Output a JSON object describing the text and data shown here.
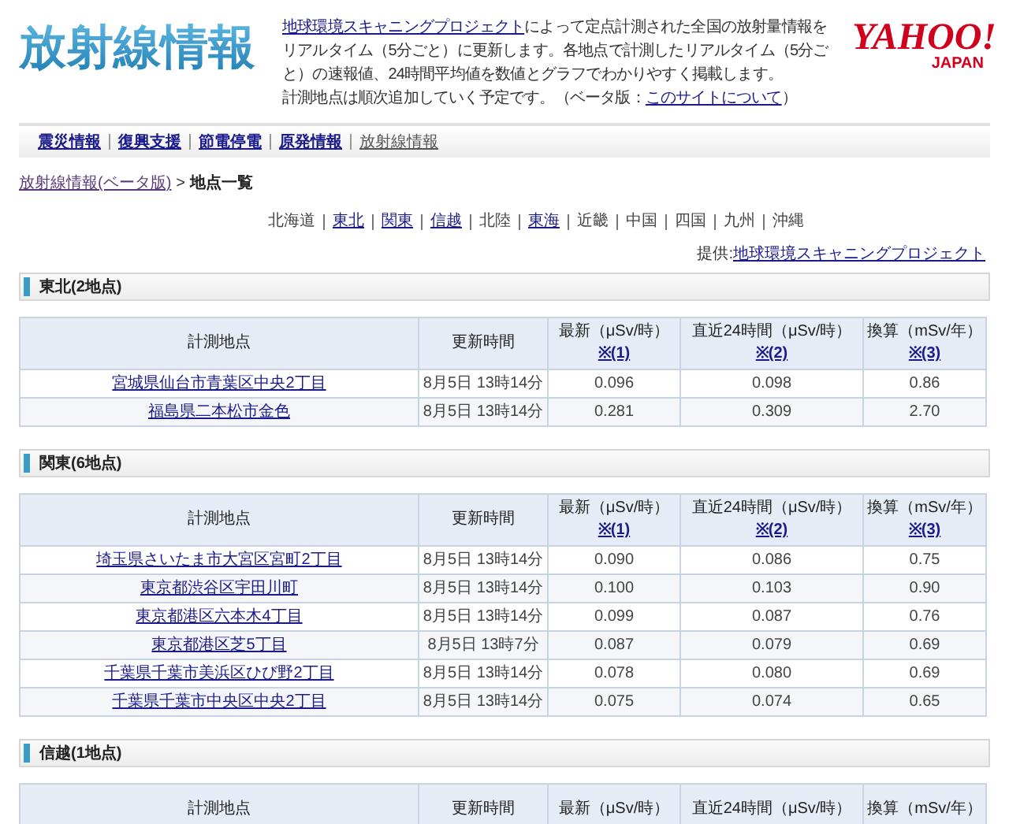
{
  "header": {
    "title": "放射線情報",
    "intro": [
      {
        "kind": "link",
        "text": "地球環境スキャニングプロジェクト"
      },
      {
        "kind": "text",
        "text": "によって定点計測された全国の放射量情報をリアルタイム（5分ごと）に更新します。各地点で計測したリアルタイム（5分ごと）の速報値、24時間平均値を数値とグラフでわかりやすく掲載します。"
      },
      {
        "kind": "break"
      },
      {
        "kind": "text",
        "text": "計測地点は順次追加していく予定です。（ベータ版："
      },
      {
        "kind": "link",
        "text": "このサイトについて"
      },
      {
        "kind": "text",
        "text": "）"
      }
    ],
    "logo": {
      "name": "YAHOO!",
      "sub": "JAPAN"
    }
  },
  "nav": [
    {
      "label": "震災情報",
      "selected": false
    },
    {
      "label": "復興支援",
      "selected": false
    },
    {
      "label": "節電停電",
      "selected": false
    },
    {
      "label": "原発情報",
      "selected": false
    },
    {
      "label": "放射線情報",
      "selected": true
    }
  ],
  "breadcrumb": {
    "link": "放射線情報(ベータ版)",
    "separator": ">",
    "current": "地点一覧"
  },
  "regions": [
    {
      "label": "北海道",
      "link": false
    },
    {
      "label": "東北",
      "link": true
    },
    {
      "label": "関東",
      "link": true
    },
    {
      "label": "信越",
      "link": true
    },
    {
      "label": "北陸",
      "link": false
    },
    {
      "label": "東海",
      "link": true
    },
    {
      "label": "近畿",
      "link": false
    },
    {
      "label": "中国",
      "link": false
    },
    {
      "label": "四国",
      "link": false
    },
    {
      "label": "九州",
      "link": false
    },
    {
      "label": "沖縄",
      "link": false
    }
  ],
  "provider": {
    "label": "提供:",
    "link": "地球環境スキャニングプロジェクト"
  },
  "sections": [
    {
      "title": "東北(2地点)",
      "columns": [
        {
          "label": "計測地点"
        },
        {
          "label": "更新時間"
        },
        {
          "label": "最新（μSv/時）",
          "note": "※(1)"
        },
        {
          "label": "直近24時間（μSv/時）",
          "note": "※(2)"
        },
        {
          "label": "換算（mSv/年）",
          "note": "※(3)"
        }
      ],
      "rows": [
        {
          "location": "宮城県仙台市青葉区中央2丁目",
          "updated": "8月5日 13時14分",
          "latest": "0.096",
          "avg24": "0.098",
          "annual": "0.86"
        },
        {
          "location": "福島県二本松市金色",
          "updated": "8月5日 13時14分",
          "latest": "0.281",
          "avg24": "0.309",
          "annual": "2.70"
        }
      ]
    },
    {
      "title": "関東(6地点)",
      "columns": [
        {
          "label": "計測地点"
        },
        {
          "label": "更新時間"
        },
        {
          "label": "最新（μSv/時）",
          "note": "※(1)"
        },
        {
          "label": "直近24時間（μSv/時）",
          "note": "※(2)"
        },
        {
          "label": "換算（mSv/年）",
          "note": "※(3)"
        }
      ],
      "rows": [
        {
          "location": "埼玉県さいたま市大宮区宮町2丁目",
          "updated": "8月5日 13時14分",
          "latest": "0.090",
          "avg24": "0.086",
          "annual": "0.75"
        },
        {
          "location": "東京都渋谷区宇田川町",
          "updated": "8月5日 13時14分",
          "latest": "0.100",
          "avg24": "0.103",
          "annual": "0.90"
        },
        {
          "location": "東京都港区六本木4丁目",
          "updated": "8月5日 13時14分",
          "latest": "0.099",
          "avg24": "0.087",
          "annual": "0.76"
        },
        {
          "location": "東京都港区芝5丁目",
          "updated": "8月5日 13時7分",
          "latest": "0.087",
          "avg24": "0.079",
          "annual": "0.69"
        },
        {
          "location": "千葉県千葉市美浜区ひび野2丁目",
          "updated": "8月5日 13時14分",
          "latest": "0.078",
          "avg24": "0.080",
          "annual": "0.69"
        },
        {
          "location": "千葉県千葉市中央区中央2丁目",
          "updated": "8月5日 13時14分",
          "latest": "0.075",
          "avg24": "0.074",
          "annual": "0.65"
        }
      ]
    },
    {
      "title": "信越(1地点)",
      "columns": [
        {
          "label": "計測地点"
        },
        {
          "label": "更新時間"
        },
        {
          "label": "最新（μSv/時）"
        },
        {
          "label": "直近24時間（μSv/時）"
        },
        {
          "label": "換算（mSv/年）"
        }
      ]
    }
  ]
}
